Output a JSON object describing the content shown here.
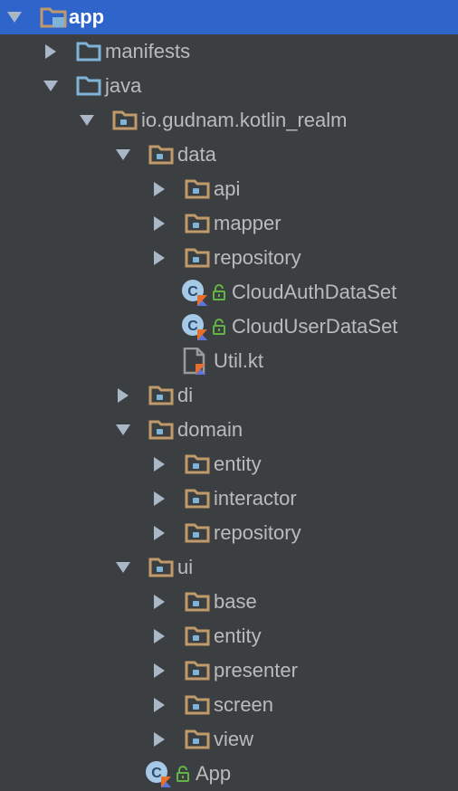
{
  "tree": [
    {
      "label": "app",
      "level": 0,
      "expanded": true,
      "type": "module",
      "selected": true
    },
    {
      "label": "manifests",
      "level": 1,
      "expanded": false,
      "type": "source-folder"
    },
    {
      "label": "java",
      "level": 1,
      "expanded": true,
      "type": "source-folder"
    },
    {
      "label": "io.gudnam.kotlin_realm",
      "level": 2,
      "expanded": true,
      "type": "package"
    },
    {
      "label": "data",
      "level": 3,
      "expanded": true,
      "type": "package"
    },
    {
      "label": "api",
      "level": 4,
      "expanded": false,
      "type": "package"
    },
    {
      "label": "mapper",
      "level": 4,
      "expanded": false,
      "type": "package"
    },
    {
      "label": "repository",
      "level": 4,
      "expanded": false,
      "type": "package"
    },
    {
      "label": "CloudAuthDataSet",
      "level": 4,
      "type": "kotlin-class",
      "locked": true
    },
    {
      "label": "CloudUserDataSet",
      "level": 4,
      "type": "kotlin-class",
      "locked": true
    },
    {
      "label": "Util.kt",
      "level": 4,
      "type": "kotlin-file"
    },
    {
      "label": "di",
      "level": 3,
      "expanded": false,
      "type": "package"
    },
    {
      "label": "domain",
      "level": 3,
      "expanded": true,
      "type": "package"
    },
    {
      "label": "entity",
      "level": 4,
      "expanded": false,
      "type": "package"
    },
    {
      "label": "interactor",
      "level": 4,
      "expanded": false,
      "type": "package"
    },
    {
      "label": "repository",
      "level": 4,
      "expanded": false,
      "type": "package"
    },
    {
      "label": "ui",
      "level": 3,
      "expanded": true,
      "type": "package"
    },
    {
      "label": "base",
      "level": 4,
      "expanded": false,
      "type": "package"
    },
    {
      "label": "entity",
      "level": 4,
      "expanded": false,
      "type": "package"
    },
    {
      "label": "presenter",
      "level": 4,
      "expanded": false,
      "type": "package"
    },
    {
      "label": "screen",
      "level": 4,
      "expanded": false,
      "type": "package"
    },
    {
      "label": "view",
      "level": 4,
      "expanded": false,
      "type": "package"
    },
    {
      "label": "App",
      "level": 3,
      "type": "kotlin-class",
      "locked": true
    }
  ],
  "colors": {
    "background": "#3c3f41",
    "selection": "#2f65ca",
    "text": "#bbbbbb",
    "selected_text": "#ffffff",
    "folder_brown": "#c19a6b",
    "folder_blue": "#7fb4d8",
    "lock_green": "#62b543",
    "kotlin_orange": "#e76f2e",
    "kotlin_blue": "#5a74e0"
  }
}
